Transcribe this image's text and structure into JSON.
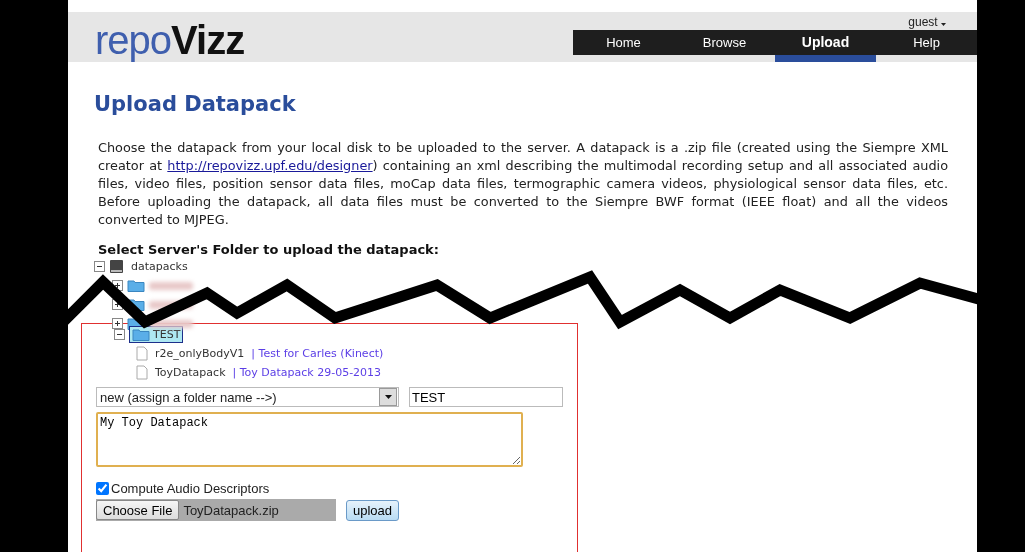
{
  "header": {
    "logo": {
      "part_1": "repo",
      "part_2": "Vizz"
    },
    "user_menu": "guest",
    "nav": [
      {
        "label": "Home",
        "selected": false
      },
      {
        "label": "Browse",
        "selected": false
      },
      {
        "label": "Upload",
        "selected": true
      },
      {
        "label": "Help",
        "selected": false
      }
    ]
  },
  "title": "Upload Datapack",
  "intro": {
    "before": "Choose the datapack from your local disk to be uploaded to the server. A datapack is a .zip file (created using the Siempre XML creator at ",
    "link": "http://repovizz.upf.edu/designer",
    "after": ") containing an xml describing the multimodal recording setup and all associated audio files, video files, position sensor data files, moCap data files, termographic camera videos, physiological sensor data files, etc. Before uploading the datapack, all data files must be converted to the Siempre BWF format (IEEE float) and all the videos converted to MJPEG."
  },
  "folder_heading": "Select Server's Folder to upload the datapack:",
  "tree": {
    "label": "datapacks",
    "expanded": true,
    "children": [
      {
        "kind": "blurred",
        "expanded": false
      },
      {
        "kind": "blurred",
        "expanded": false
      },
      {
        "kind": "blurred",
        "expanded": false
      },
      {
        "kind": "folder",
        "label": "TEST",
        "expanded": true,
        "selected": true,
        "children": [
          {
            "kind": "file",
            "label": "r2e_onlyBodyV1",
            "description": "| Test for Carles (Kinect)"
          },
          {
            "kind": "file",
            "label": "ToyDatapack",
            "description": "| Toy Datapack 29-05-2013"
          }
        ]
      }
    ]
  },
  "form": {
    "folder_select": "new (assign a folder name -->)",
    "folder_name": "TEST",
    "description": "My Toy Datapack",
    "compute_audio": {
      "label": "Compute Audio Descriptors",
      "checked": true
    },
    "file_button": "Choose File",
    "file_name": "ToyDatapack.zip",
    "upload_button": "upload"
  }
}
